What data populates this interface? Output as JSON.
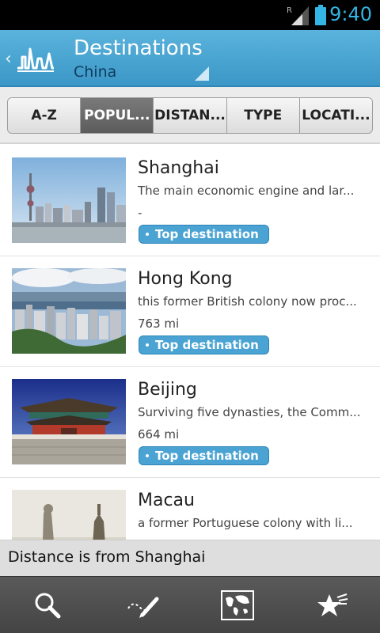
{
  "status": {
    "time": "9:40",
    "roaming": "R"
  },
  "header": {
    "title": "Destinations",
    "subtitle": "China"
  },
  "tabs": [
    {
      "label": "A-Z",
      "active": false
    },
    {
      "label": "POPUL...",
      "active": true
    },
    {
      "label": "DISTAN...",
      "active": false
    },
    {
      "label": "TYPE",
      "active": false
    },
    {
      "label": "LOCATI...",
      "active": false
    }
  ],
  "items": [
    {
      "name": "Shanghai",
      "description": "The main economic engine and lar...",
      "distance": "-",
      "badge": "Top destination"
    },
    {
      "name": "Hong Kong",
      "description": "this former British colony now proc...",
      "distance": "763 mi",
      "badge": "Top destination"
    },
    {
      "name": "Beijing",
      "description": "Surviving five dynasties, the Comm...",
      "distance": "664 mi",
      "badge": "Top destination"
    },
    {
      "name": "Macau",
      "description": "a former Portuguese colony with li...",
      "distance": "",
      "badge": ""
    }
  ],
  "footer_note": "Distance is from Shanghai",
  "bottom_nav": [
    {
      "icon": "search-icon"
    },
    {
      "icon": "sketch-pencil-icon"
    },
    {
      "icon": "world-map-icon"
    },
    {
      "icon": "favorites-star-icon"
    }
  ],
  "colors": {
    "accent": "#33b5e5",
    "appbar": "#4aa3d3",
    "badge": "#4aa3d3"
  }
}
